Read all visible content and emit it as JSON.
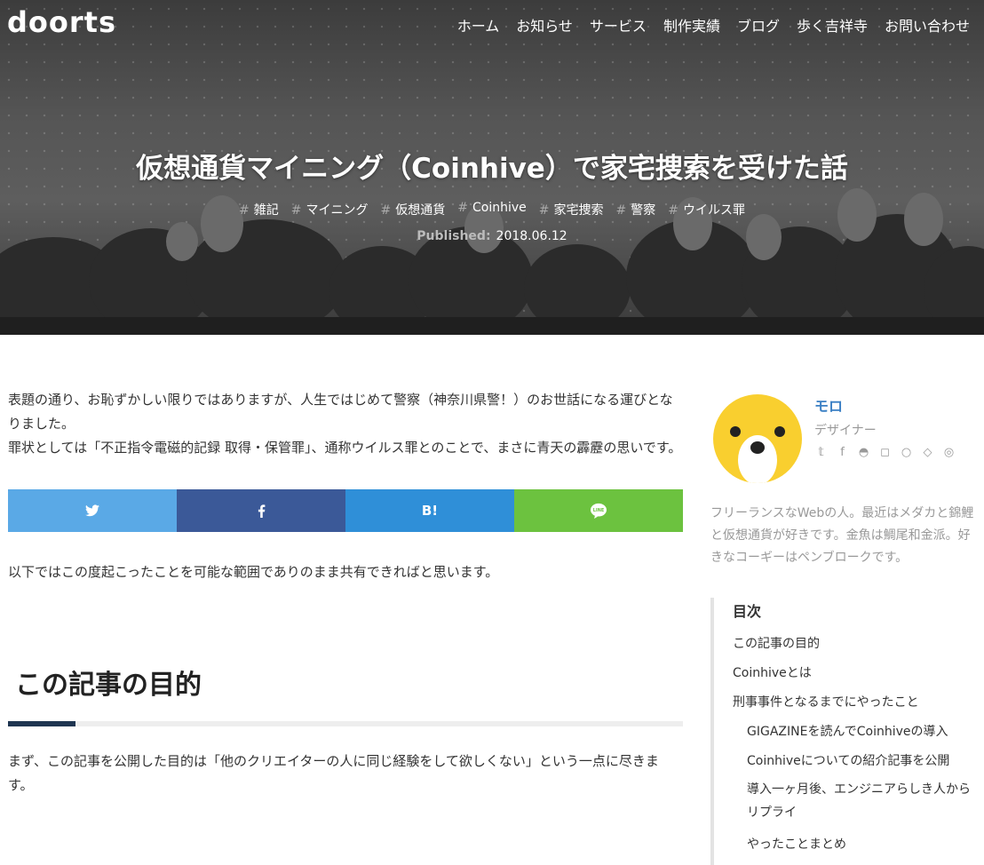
{
  "site": {
    "logo": "doorts"
  },
  "nav": {
    "items": [
      "ホーム",
      "お知らせ",
      "サービス",
      "制作実績",
      "ブログ",
      "歩く吉祥寺",
      "お問い合わせ"
    ]
  },
  "article": {
    "title": "仮想通貨マイニング（Coinhive）で家宅捜索を受けた話",
    "tags": [
      "雑記",
      "マイニング",
      "仮想通貨",
      "Coinhive",
      "家宅捜索",
      "警察",
      "ウイルス罪"
    ],
    "published_label": "Published:",
    "published_date": "2018.06.12",
    "intro_1": "表題の通り、お恥ずかしい限りではありますが、人生ではじめて警察（神奈川県警！）のお世話になる運びとなりました。",
    "intro_2": "罪状としては「不正指令電磁的記録 取得・保管罪」、通称ウイルス罪とのことで、まさに青天の霹靂の思いです。",
    "para_2": "以下ではこの度起こったことを可能な範囲でありのまま共有できればと思います。",
    "section_1_title": "この記事の目的",
    "para_3": "まず、この記事を公開した目的は「他のクリエイターの人に同じ経験をして欲しくない」という一点に尽きます。"
  },
  "share": {
    "twitter": "twitter-icon",
    "facebook": "facebook-icon",
    "hatena": "B!",
    "line": "LINE"
  },
  "colors": {
    "twitter": "#5aa9e6",
    "facebook": "#3b5998",
    "hatena": "#2f8fd8",
    "line": "#6cc23f",
    "accent": "#1f3551",
    "name": "#3a7fc4"
  },
  "profile": {
    "name": "モロ",
    "role": "デザイナー",
    "sns": [
      "twitter-icon",
      "facebook-icon",
      "github-icon",
      "instagram-icon",
      "search-icon",
      "codepen-icon",
      "dribbble-icon"
    ],
    "bio": "フリーランスなWebの人。最近はメダカと錦鯉と仮想通貨が好きです。金魚は鯛尾和金派。好きなコーギーはペンブロークです。"
  },
  "toc": {
    "title": "目次",
    "items": [
      {
        "label": "この記事の目的",
        "level": 1
      },
      {
        "label": "Coinhiveとは",
        "level": 1
      },
      {
        "label": "刑事事件となるまでにやったこと",
        "level": 1
      },
      {
        "label": "GIGAZINEを読んでCoinhiveの導入",
        "level": 2
      },
      {
        "label": "Coinhiveについての紹介記事を公開",
        "level": 2
      },
      {
        "label": "導入一ヶ月後、エンジニアらしき人からリプライ",
        "level": 2
      },
      {
        "label": "やったことまとめ",
        "level": 2
      }
    ]
  }
}
